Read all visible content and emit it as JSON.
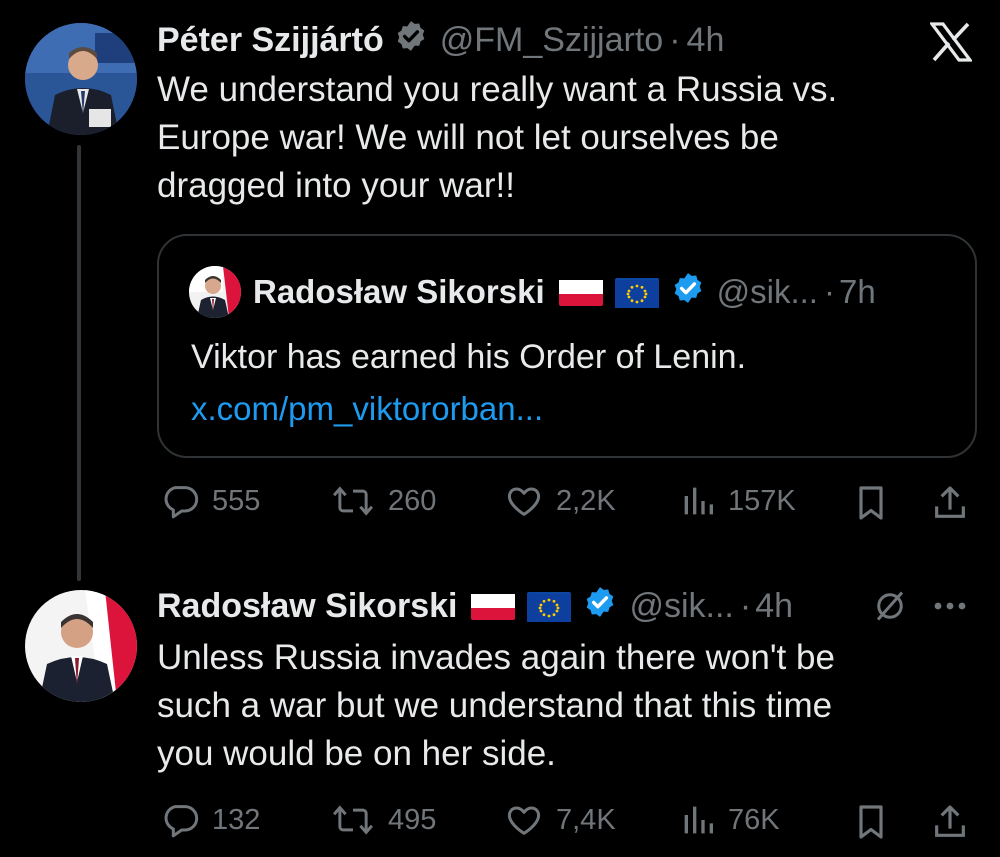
{
  "tweet1": {
    "author_name": "Péter Szijjártó",
    "handle": "@FM_Szijjarto",
    "separator": "·",
    "time": "4h",
    "text_lines": [
      "We understand you really want a Russia vs.",
      "Europe war! We will not let ourselves be",
      "dragged into your war!!"
    ],
    "quote": {
      "author_name": "Radosław Sikorski",
      "handle": "@sik...",
      "separator": "·",
      "time": "7h",
      "text": "Viktor has earned his Order of Lenin.",
      "link": "x.com/pm_viktororban..."
    },
    "stats": {
      "replies": "555",
      "reposts": "260",
      "likes": "2,2K",
      "views": "157K"
    }
  },
  "tweet2": {
    "author_name": "Radosław Sikorski",
    "handle": "@sik...",
    "separator": "·",
    "time": "4h",
    "text_lines": [
      "Unless Russia invades again there won't be",
      "such a war but we understand that this time",
      "you would be on her side."
    ],
    "stats": {
      "replies": "132",
      "reposts": "495",
      "likes": "7,4K",
      "views": "76K"
    }
  },
  "colors": {
    "background": "#000000",
    "text": "#e7e9ea",
    "muted": "#71767b",
    "link": "#1d9bf0",
    "verified": "#1d9bf0"
  }
}
